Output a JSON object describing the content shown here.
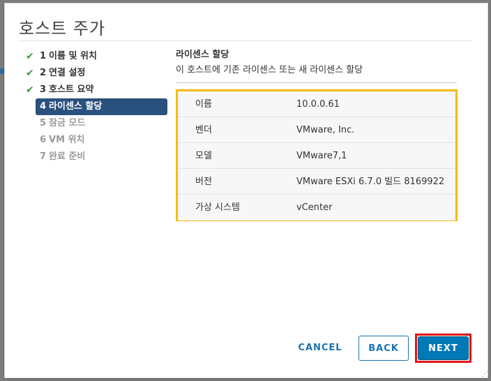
{
  "dialog": {
    "title": "호스트 주가"
  },
  "steps": [
    {
      "num": "1",
      "label": "이름 및 위치",
      "state": "done"
    },
    {
      "num": "2",
      "label": "연결 설정",
      "state": "done"
    },
    {
      "num": "3",
      "label": "호스트 요약",
      "state": "done"
    },
    {
      "num": "4",
      "label": "라이센스 할당",
      "state": "active"
    },
    {
      "num": "5",
      "label": "잠금 모드",
      "state": "pending"
    },
    {
      "num": "6",
      "label": "VM 위치",
      "state": "pending"
    },
    {
      "num": "7",
      "label": "완료 준비",
      "state": "pending"
    }
  ],
  "section": {
    "title": "라이센스 할당",
    "description": "이 호스트에 기존 라이센스 또는 새 라이센스 할당"
  },
  "info": [
    {
      "key": "이름",
      "value": "10.0.0.61"
    },
    {
      "key": "벤더",
      "value": "VMware, Inc."
    },
    {
      "key": "모델",
      "value": "VMware7,1"
    },
    {
      "key": "버전",
      "value": "VMware ESXi 6.7.0 빌드 8169922"
    },
    {
      "key": "가상 시스템",
      "value": "vCenter"
    }
  ],
  "buttons": {
    "cancel": "CANCEL",
    "back": "BACK",
    "next": "NEXT"
  },
  "icons": {
    "check": "check-icon",
    "grip": "resize-grip-icon"
  },
  "colors": {
    "accent": "#0079b8",
    "active_step": "#2a517e",
    "check_green": "#3c9a3c",
    "highlight_yellow": "#f5bb13",
    "highlight_red": "#e3131a"
  }
}
